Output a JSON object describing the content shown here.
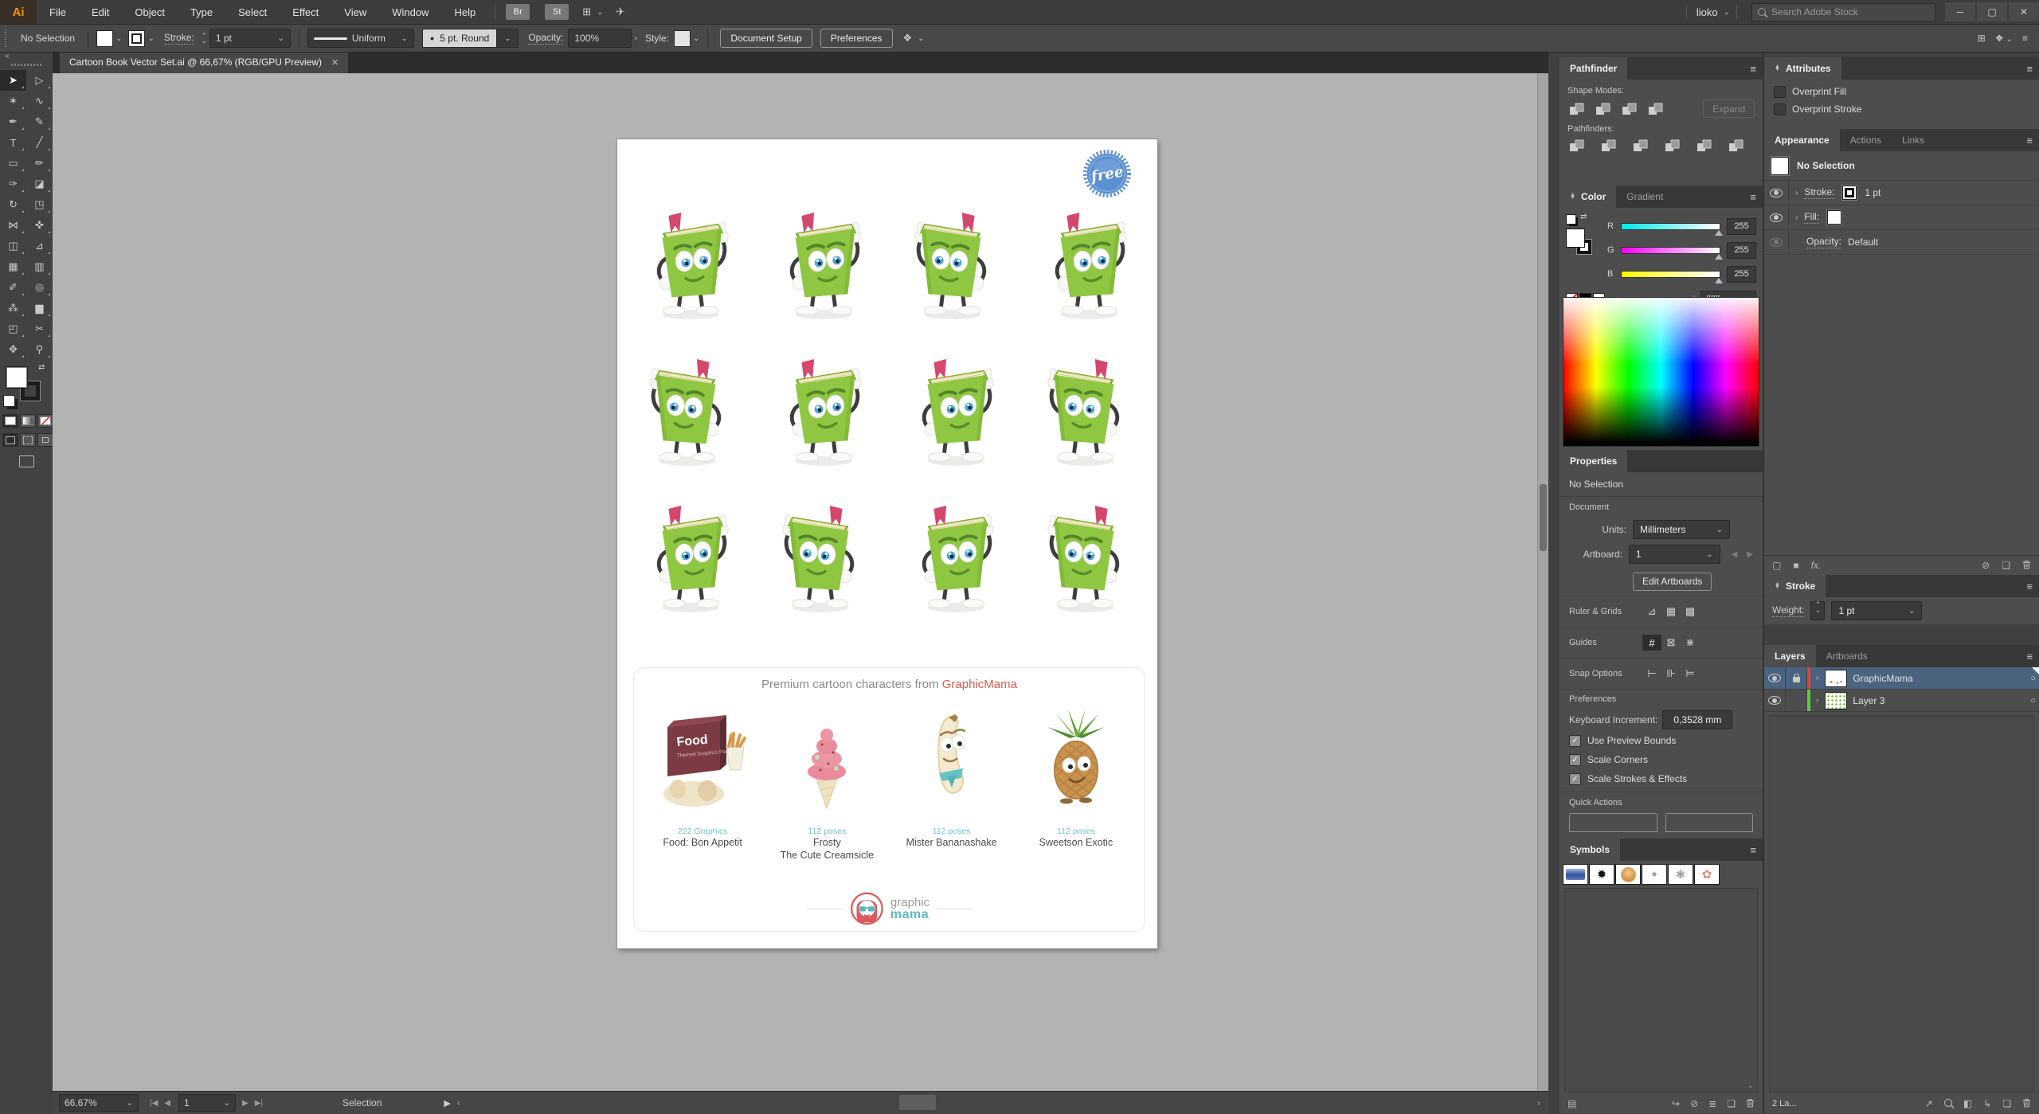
{
  "app": {
    "logo": "Ai",
    "menu": [
      {
        "name": "menu-file",
        "label": "File"
      },
      {
        "name": "menu-edit",
        "label": "Edit"
      },
      {
        "name": "menu-object",
        "label": "Object"
      },
      {
        "name": "menu-type",
        "label": "Type"
      },
      {
        "name": "menu-select",
        "label": "Select"
      },
      {
        "name": "menu-effect",
        "label": "Effect"
      },
      {
        "name": "menu-view",
        "label": "View"
      },
      {
        "name": "menu-window",
        "label": "Window"
      },
      {
        "name": "menu-help",
        "label": "Help"
      }
    ],
    "bridge": "Br",
    "stock": "St",
    "user": "lioko",
    "search_placeholder": "Search Adobe Stock"
  },
  "options": {
    "no_selection": "No Selection",
    "stroke_label": "Stroke:",
    "stroke_weight": "1 pt",
    "width_profile": "Uniform",
    "brush": "5 pt. Round",
    "opacity_label": "Opacity:",
    "opacity_value": "100%",
    "style_label": "Style:",
    "document_setup": "Document Setup",
    "preferences": "Preferences"
  },
  "document_tab": {
    "title": "Cartoon Book Vector Set.ai @ 66,67%  (RGB/GPU Preview)"
  },
  "tools": [
    {
      "name": "selection-tool",
      "glyph": "➤",
      "active": true
    },
    {
      "name": "direct-selection-tool",
      "glyph": "▷"
    },
    {
      "name": "magic-wand-tool",
      "glyph": "✶"
    },
    {
      "name": "lasso-tool",
      "glyph": "∿"
    },
    {
      "name": "pen-tool",
      "glyph": "✒"
    },
    {
      "name": "curvature-tool",
      "glyph": "✎"
    },
    {
      "name": "type-tool",
      "glyph": "T"
    },
    {
      "name": "line-segment-tool",
      "glyph": "╱"
    },
    {
      "name": "rectangle-tool",
      "glyph": "▭"
    },
    {
      "name": "paintbrush-tool",
      "glyph": "✏"
    },
    {
      "name": "shaper-tool",
      "glyph": "✑"
    },
    {
      "name": "eraser-tool",
      "glyph": "◪"
    },
    {
      "name": "rotate-tool",
      "glyph": "↻"
    },
    {
      "name": "scale-tool",
      "glyph": "◳"
    },
    {
      "name": "width-tool",
      "glyph": "⋈"
    },
    {
      "name": "puppet-warp-tool",
      "glyph": "✜"
    },
    {
      "name": "shape-builder-tool",
      "glyph": "◫"
    },
    {
      "name": "perspective-grid-tool",
      "glyph": "⊿"
    },
    {
      "name": "mesh-tool",
      "glyph": "▦"
    },
    {
      "name": "gradient-tool",
      "glyph": "▥"
    },
    {
      "name": "eyedropper-tool",
      "glyph": "✐"
    },
    {
      "name": "blend-tool",
      "glyph": "◎"
    },
    {
      "name": "symbol-sprayer-tool",
      "glyph": "⁂"
    },
    {
      "name": "column-graph-tool",
      "glyph": "▆"
    },
    {
      "name": "artboard-tool",
      "glyph": "◰"
    },
    {
      "name": "slice-tool",
      "glyph": "✂"
    },
    {
      "name": "hand-tool",
      "glyph": "✥"
    },
    {
      "name": "zoom-tool",
      "glyph": "⚲"
    }
  ],
  "panels": {
    "pathfinder": {
      "title": "Pathfinder",
      "shape_modes": "Shape Modes:",
      "pathfinders": "Pathfinders:",
      "expand": "Expand"
    },
    "color": {
      "title": "Color",
      "gradient": "Gradient",
      "r": "R",
      "g": "G",
      "b": "B",
      "r_value": "255",
      "g_value": "255",
      "b_value": "255",
      "hash": "#",
      "hex": "ffffff"
    },
    "properties": {
      "title": "Properties",
      "no_selection": "No Selection",
      "document": "Document",
      "units_label": "Units:",
      "units": "Millimeters",
      "artboard_label": "Artboard:",
      "artboard": "1",
      "edit_artboards": "Edit Artboards",
      "ruler_grids": "Ruler & Grids",
      "guides": "Guides",
      "snap": "Snap Options",
      "preferences": "Preferences",
      "keyboard_increment_label": "Keyboard Increment:",
      "keyboard_increment": "0,3528 mm",
      "cb1": "Use Preview Bounds",
      "cb2": "Scale Corners",
      "cb3": "Scale Strokes & Effects",
      "quick_actions": "Quick Actions"
    },
    "symbols": {
      "title": "Symbols"
    },
    "attributes": {
      "title": "Attributes",
      "overprint_fill": "Overprint Fill",
      "overprint_stroke": "Overprint Stroke"
    },
    "appearance": {
      "title": "Appearance",
      "actions": "Actions",
      "links": "Links",
      "no_selection": "No Selection",
      "stroke_label": "Stroke:",
      "stroke_value": "1 pt",
      "fill_label": "Fill:",
      "opacity_label": "Opacity:",
      "opacity_value": "Default",
      "fx": "fx."
    },
    "stroke": {
      "title": "Stroke",
      "weight_label": "Weight:",
      "weight": "1 pt"
    },
    "layers": {
      "title": "Layers",
      "artboards": "Artboards",
      "count": "2 La...",
      "items": [
        {
          "name": "GraphicMama"
        },
        {
          "name": "Layer 3"
        }
      ]
    }
  },
  "artboard": {
    "badge": "free",
    "heading": "Premium cartoon characters from ",
    "brand": "GraphicMama",
    "products": [
      {
        "count": "222 Graphics",
        "name": "Food: Bon Appetit",
        "name2": "",
        "box_label": "Food"
      },
      {
        "count": "112 poses",
        "name": "Frosty",
        "name2": "The Cute Creamsicle"
      },
      {
        "count": "112 poses",
        "name": "Mister Bananashake",
        "name2": ""
      },
      {
        "count": "112 poses",
        "name": "Sweetson Exotic",
        "name2": ""
      }
    ],
    "logo1": "graphic",
    "logo2": "mama"
  },
  "status": {
    "zoom": "66,67%",
    "artboard": "1",
    "tool": "Selection"
  },
  "icons": {
    "chevron_down": "⌄",
    "chevron_up": "⌃",
    "chevron_right": "›",
    "chevron_left": "‹",
    "collapse": "«",
    "menu": "≡",
    "close": "✕",
    "minimize": "─",
    "restore": "▢",
    "target": "○",
    "nav_first": "|◀",
    "nav_prev": "◀",
    "nav_next": "▶",
    "nav_last": "▶|",
    "play": "▶",
    "swap": "⇄",
    "ruler": "⊿",
    "grid": "▦",
    "transparency": "▩",
    "guides": "#",
    "guides_lock": "⊠",
    "smart_guides": "⋇",
    "snap_grid": "⊢",
    "snap_pixel": "⊪",
    "snap_point": "⊨",
    "export": "↗",
    "sublayer": "↳",
    "new_item": "❏",
    "clip_mask": "◧",
    "break_link": "⊘",
    "list": "≣",
    "library": "▤",
    "place": "↪",
    "add_fill": "■",
    "add_stroke": "▢",
    "clear": "⊘",
    "fx": "fx.",
    "arrange": "⊞",
    "workspace": "❖",
    "gpu": "✈",
    "dot": "●"
  },
  "colors": {
    "book_green": "#8fc642",
    "bookmark_pink": "#d6476d",
    "eye_blue": "#49a8e0",
    "badge_blue": "#5b8fd0",
    "brand_red": "#e2574c",
    "brand_teal": "#5bb9bf",
    "layer_selected": "#4a6480",
    "layer_color_graphicmama": "#e0443e",
    "layer_color_layer3": "#52d241"
  }
}
